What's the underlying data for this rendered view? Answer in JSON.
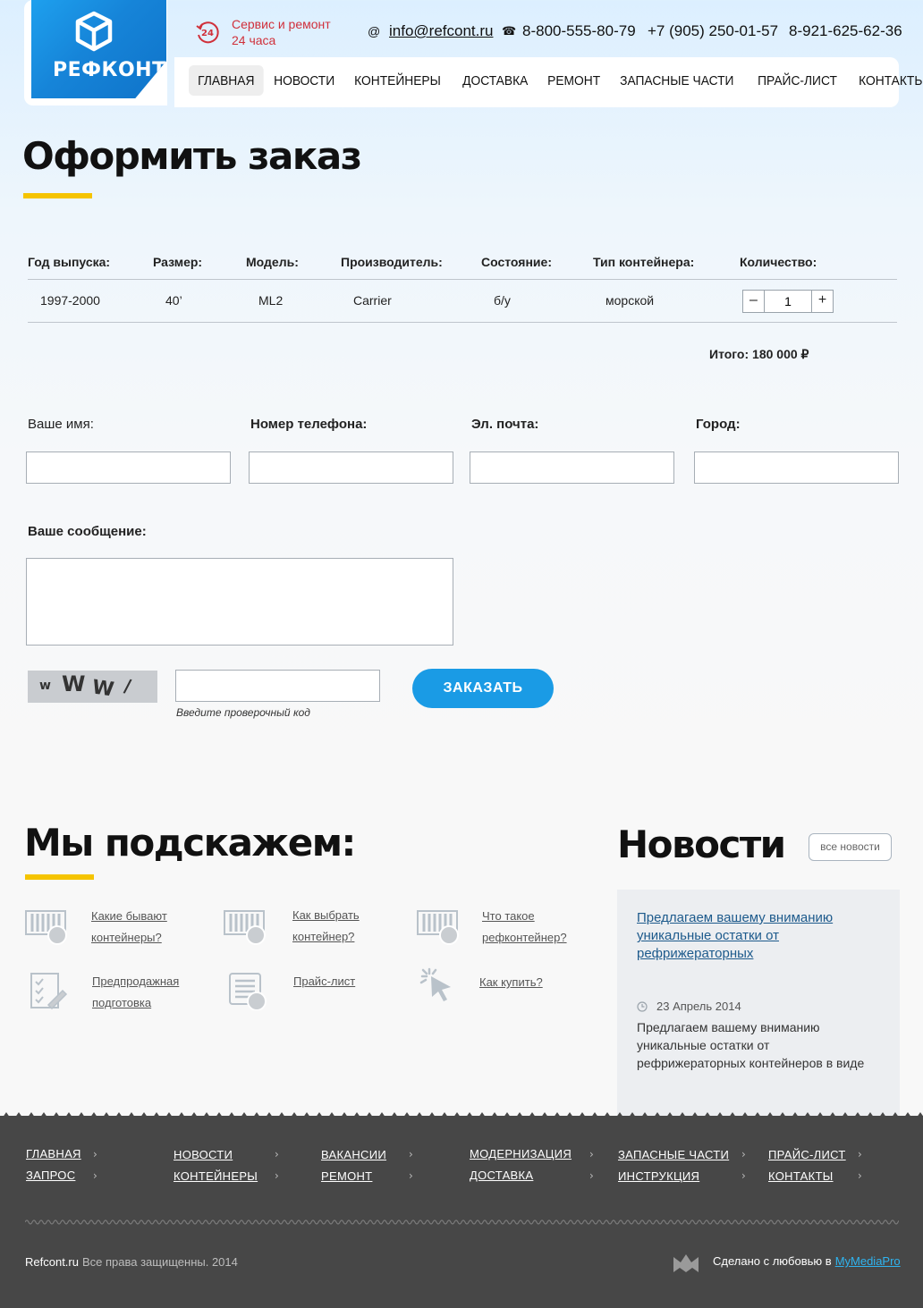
{
  "header": {
    "logo_text": "РЕФКОНТ",
    "service_line1": "Сервис и ремонт",
    "service_line2": "24 часа",
    "service_badge": "24",
    "email_symbol": "@",
    "email": "info@refcont.ru",
    "phone_symbol": "☎",
    "phone1": "8-800-555-80-79",
    "phone2": "+7 (905) 250-01-57",
    "phone3": "8-921-625-62-36",
    "nav": [
      "ГЛАВНАЯ",
      "НОВОСТИ",
      "КОНТЕЙНЕРЫ",
      "ДОСТАВКА",
      "РЕМОНТ",
      "ЗАПАСНЫЕ ЧАСТИ",
      "ПРАЙС-ЛИСТ",
      "КОНТАКТЫ"
    ],
    "nav_active": "ГЛАВНАЯ"
  },
  "page_title": "Оформить заказ",
  "order": {
    "headers": [
      "Год выпуска:",
      "Размер:",
      "Модель:",
      "Производитель:",
      "Состояние:",
      "Тип контейнера:",
      "Количество:"
    ],
    "row": [
      "1997-2000",
      "40’",
      "ML2",
      "Carrier",
      "б/у",
      "морской"
    ],
    "quantity": "1",
    "minus": "–",
    "plus": "+",
    "total": "Итого: 180 000  ₽"
  },
  "form": {
    "name_label": "Ваше имя:",
    "phone_label": "Номер телефона:",
    "email_label": "Эл. почта:",
    "city_label": "Город:",
    "message_label": "Ваше сообщение:",
    "captcha_chars": [
      "w",
      "W",
      "W",
      "/"
    ],
    "captcha_hint": "Введите проверочный код",
    "submit": "ЗАКАЗАТЬ"
  },
  "hints": {
    "title": "Мы подскажем:",
    "items": [
      {
        "label": "Какие бывают контейнеры?",
        "icon": "containers-icon"
      },
      {
        "label": "Как выбрать контейнер?",
        "icon": "containers-icon"
      },
      {
        "label": "Что такое рефконтейнер?",
        "icon": "containers-icon"
      },
      {
        "label": "Предпродажная подготовка",
        "icon": "checklist-icon"
      },
      {
        "label": "Прайс-лист",
        "icon": "price-list-icon"
      },
      {
        "label": "Как купить?",
        "icon": "cursor-click-icon"
      }
    ]
  },
  "news": {
    "title": "Новости",
    "all_news": "все новости",
    "item_title": "Предлагаем вашему вниманию уникальные остатки от рефрижераторных",
    "item_date": "23 Апрель 2014",
    "item_text": "Предлагаем вашему вниманию уникальные остатки от рефрижераторных контейнеров в виде"
  },
  "footer": {
    "columns": [
      [
        "ГЛАВНАЯ",
        "ЗАПРОС"
      ],
      [
        "НОВОСТИ",
        "КОНТЕЙНЕРЫ"
      ],
      [
        "ВАКАНСИИ",
        "РЕМОНТ"
      ],
      [
        "МОДЕРНИЗАЦИЯ",
        "ДОСТАВКА"
      ],
      [
        "ЗАПАСНЫЕ ЧАСТИ",
        "ИНСТРУКЦИЯ"
      ],
      [
        "ПРАЙС-ЛИСТ",
        "КОНТАКТЫ"
      ]
    ],
    "arrow": "›",
    "site": "Refcont.ru",
    "rights": "Все права защищенны. 2014",
    "made_with": "Сделано с любовью в",
    "studio": "MyMediaPro"
  },
  "colors": {
    "accent_blue": "#1a9be5",
    "accent_yellow": "#f5c400",
    "service_red": "#d0303a",
    "footer_bg": "#474747",
    "link_blue": "#2fb4f0"
  }
}
